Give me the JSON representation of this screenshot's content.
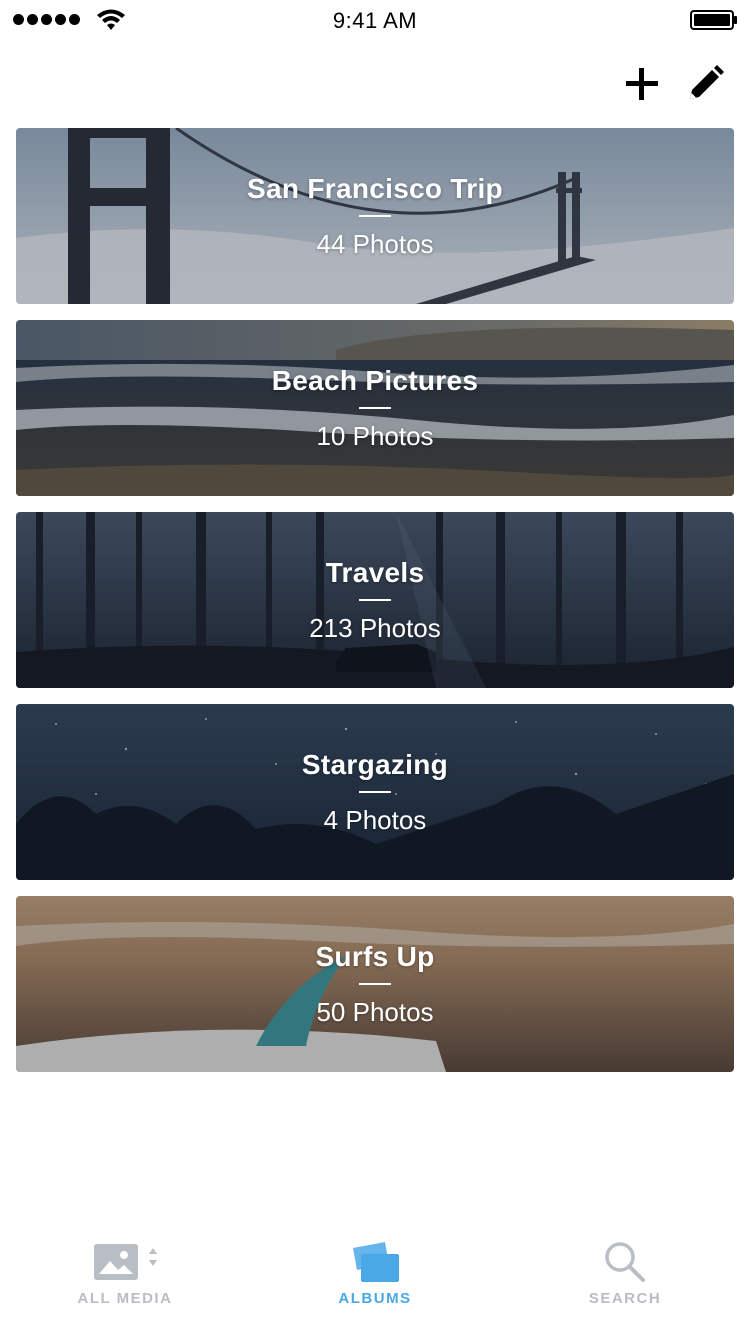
{
  "status_bar": {
    "time": "9:41 AM"
  },
  "albums": [
    {
      "title": "San Francisco Trip",
      "count": "44 Photos"
    },
    {
      "title": "Beach Pictures",
      "count": "10 Photos"
    },
    {
      "title": "Travels",
      "count": "213 Photos"
    },
    {
      "title": "Stargazing",
      "count": "4 Photos"
    },
    {
      "title": "Surfs Up",
      "count": "50 Photos"
    }
  ],
  "tabs": [
    {
      "label": "ALL MEDIA",
      "icon": "image-icon",
      "active": false
    },
    {
      "label": "ALBUMS",
      "icon": "albums-icon",
      "active": true
    },
    {
      "label": "SEARCH",
      "icon": "search-icon",
      "active": false
    }
  ],
  "colors": {
    "accent": "#4aa8e6",
    "inactive": "#b9bec4"
  }
}
